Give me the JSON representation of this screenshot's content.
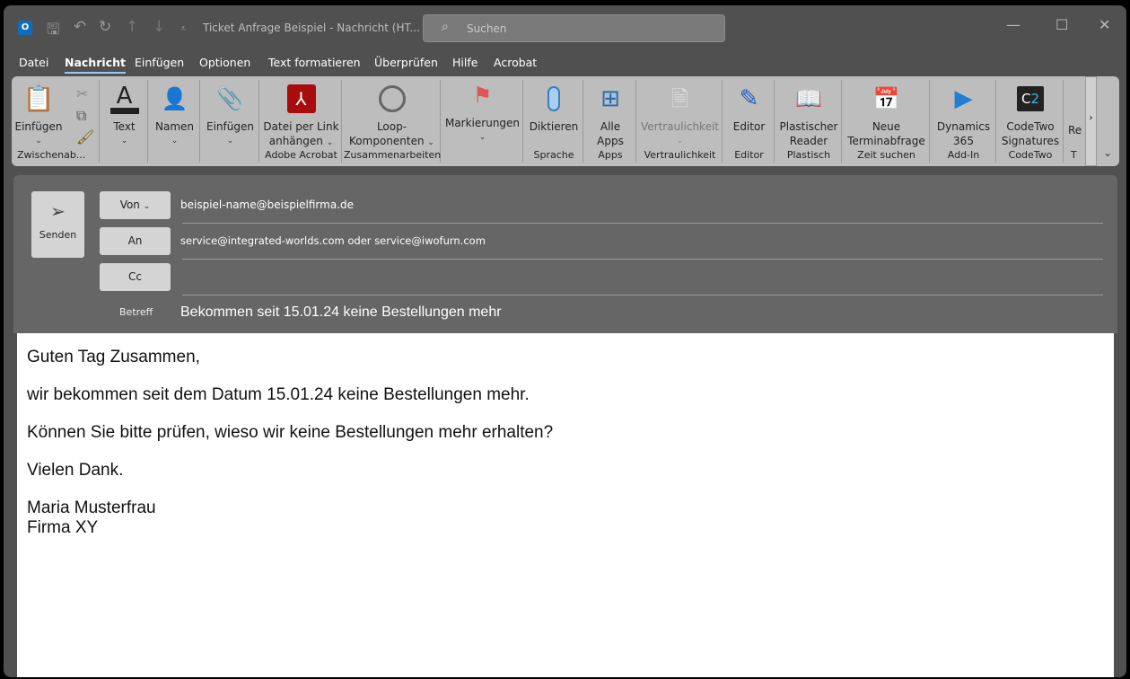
{
  "titlebar": {
    "title": "Ticket Anfrage Beispiel  -  Nachricht (HT...",
    "search_placeholder": "Suchen"
  },
  "menu": [
    "Datei",
    "Nachricht",
    "Einfügen",
    "Optionen",
    "Text formatieren",
    "Überprüfen",
    "Hilfe",
    "Acrobat"
  ],
  "ribbon": {
    "paste": "Einfügen",
    "clipboard_group": "Zwischenab...",
    "text": "Text",
    "names": "Namen",
    "insert": "Einfügen",
    "acrobat_l1": "Datei per Link",
    "acrobat_l2": "anhängen",
    "acrobat_group": "Adobe Acrobat",
    "loop_l1": "Loop-",
    "loop_l2": "Komponenten",
    "loop_group": "Zusammenarbeiten",
    "flags": "Markierungen",
    "dictate": "Diktieren",
    "speech_group": "Sprache",
    "apps_l1": "Alle",
    "apps_l2": "Apps",
    "apps_group": "Apps",
    "sensitivity": "Vertraulichkeit",
    "sensitivity_group": "Vertraulichkeit",
    "editor": "Editor",
    "editor_group": "Editor",
    "reader_l1": "Plastischer",
    "reader_l2": "Reader",
    "reader_group": "Plastisch",
    "poll_l1": "Neue",
    "poll_l2": "Terminabfrage",
    "poll_group": "Zeit suchen",
    "dyn_l1": "Dynamics",
    "dyn_l2": "365",
    "dyn_group": "Add-In",
    "c2_l1": "CodeTwo",
    "c2_l2": "Signatures",
    "c2_group": "CodeTwo",
    "trunc": "Re",
    "trunc_group": "T"
  },
  "compose": {
    "send": "Senden",
    "from_label": "Von",
    "from": "beispiel-name@beispielfirma.de",
    "to_label": "An",
    "to": "service@integrated-worlds.com oder service@iwofurn.com",
    "cc_label": "Cc",
    "cc": "",
    "subject_label": "Betreff",
    "subject": "Bekommen seit 15.01.24 keine Bestellungen mehr"
  },
  "body": {
    "greeting": "Guten Tag Zusammen,",
    "line1": "wir bekommen seit dem Datum 15.01.24 keine Bestellungen mehr.",
    "line2": "Können Sie bitte prüfen, wieso wir keine Bestellungen mehr erhalten?",
    "thanks": "Vielen Dank.",
    "name": "Maria Musterfrau",
    "company": "Firma XY"
  }
}
